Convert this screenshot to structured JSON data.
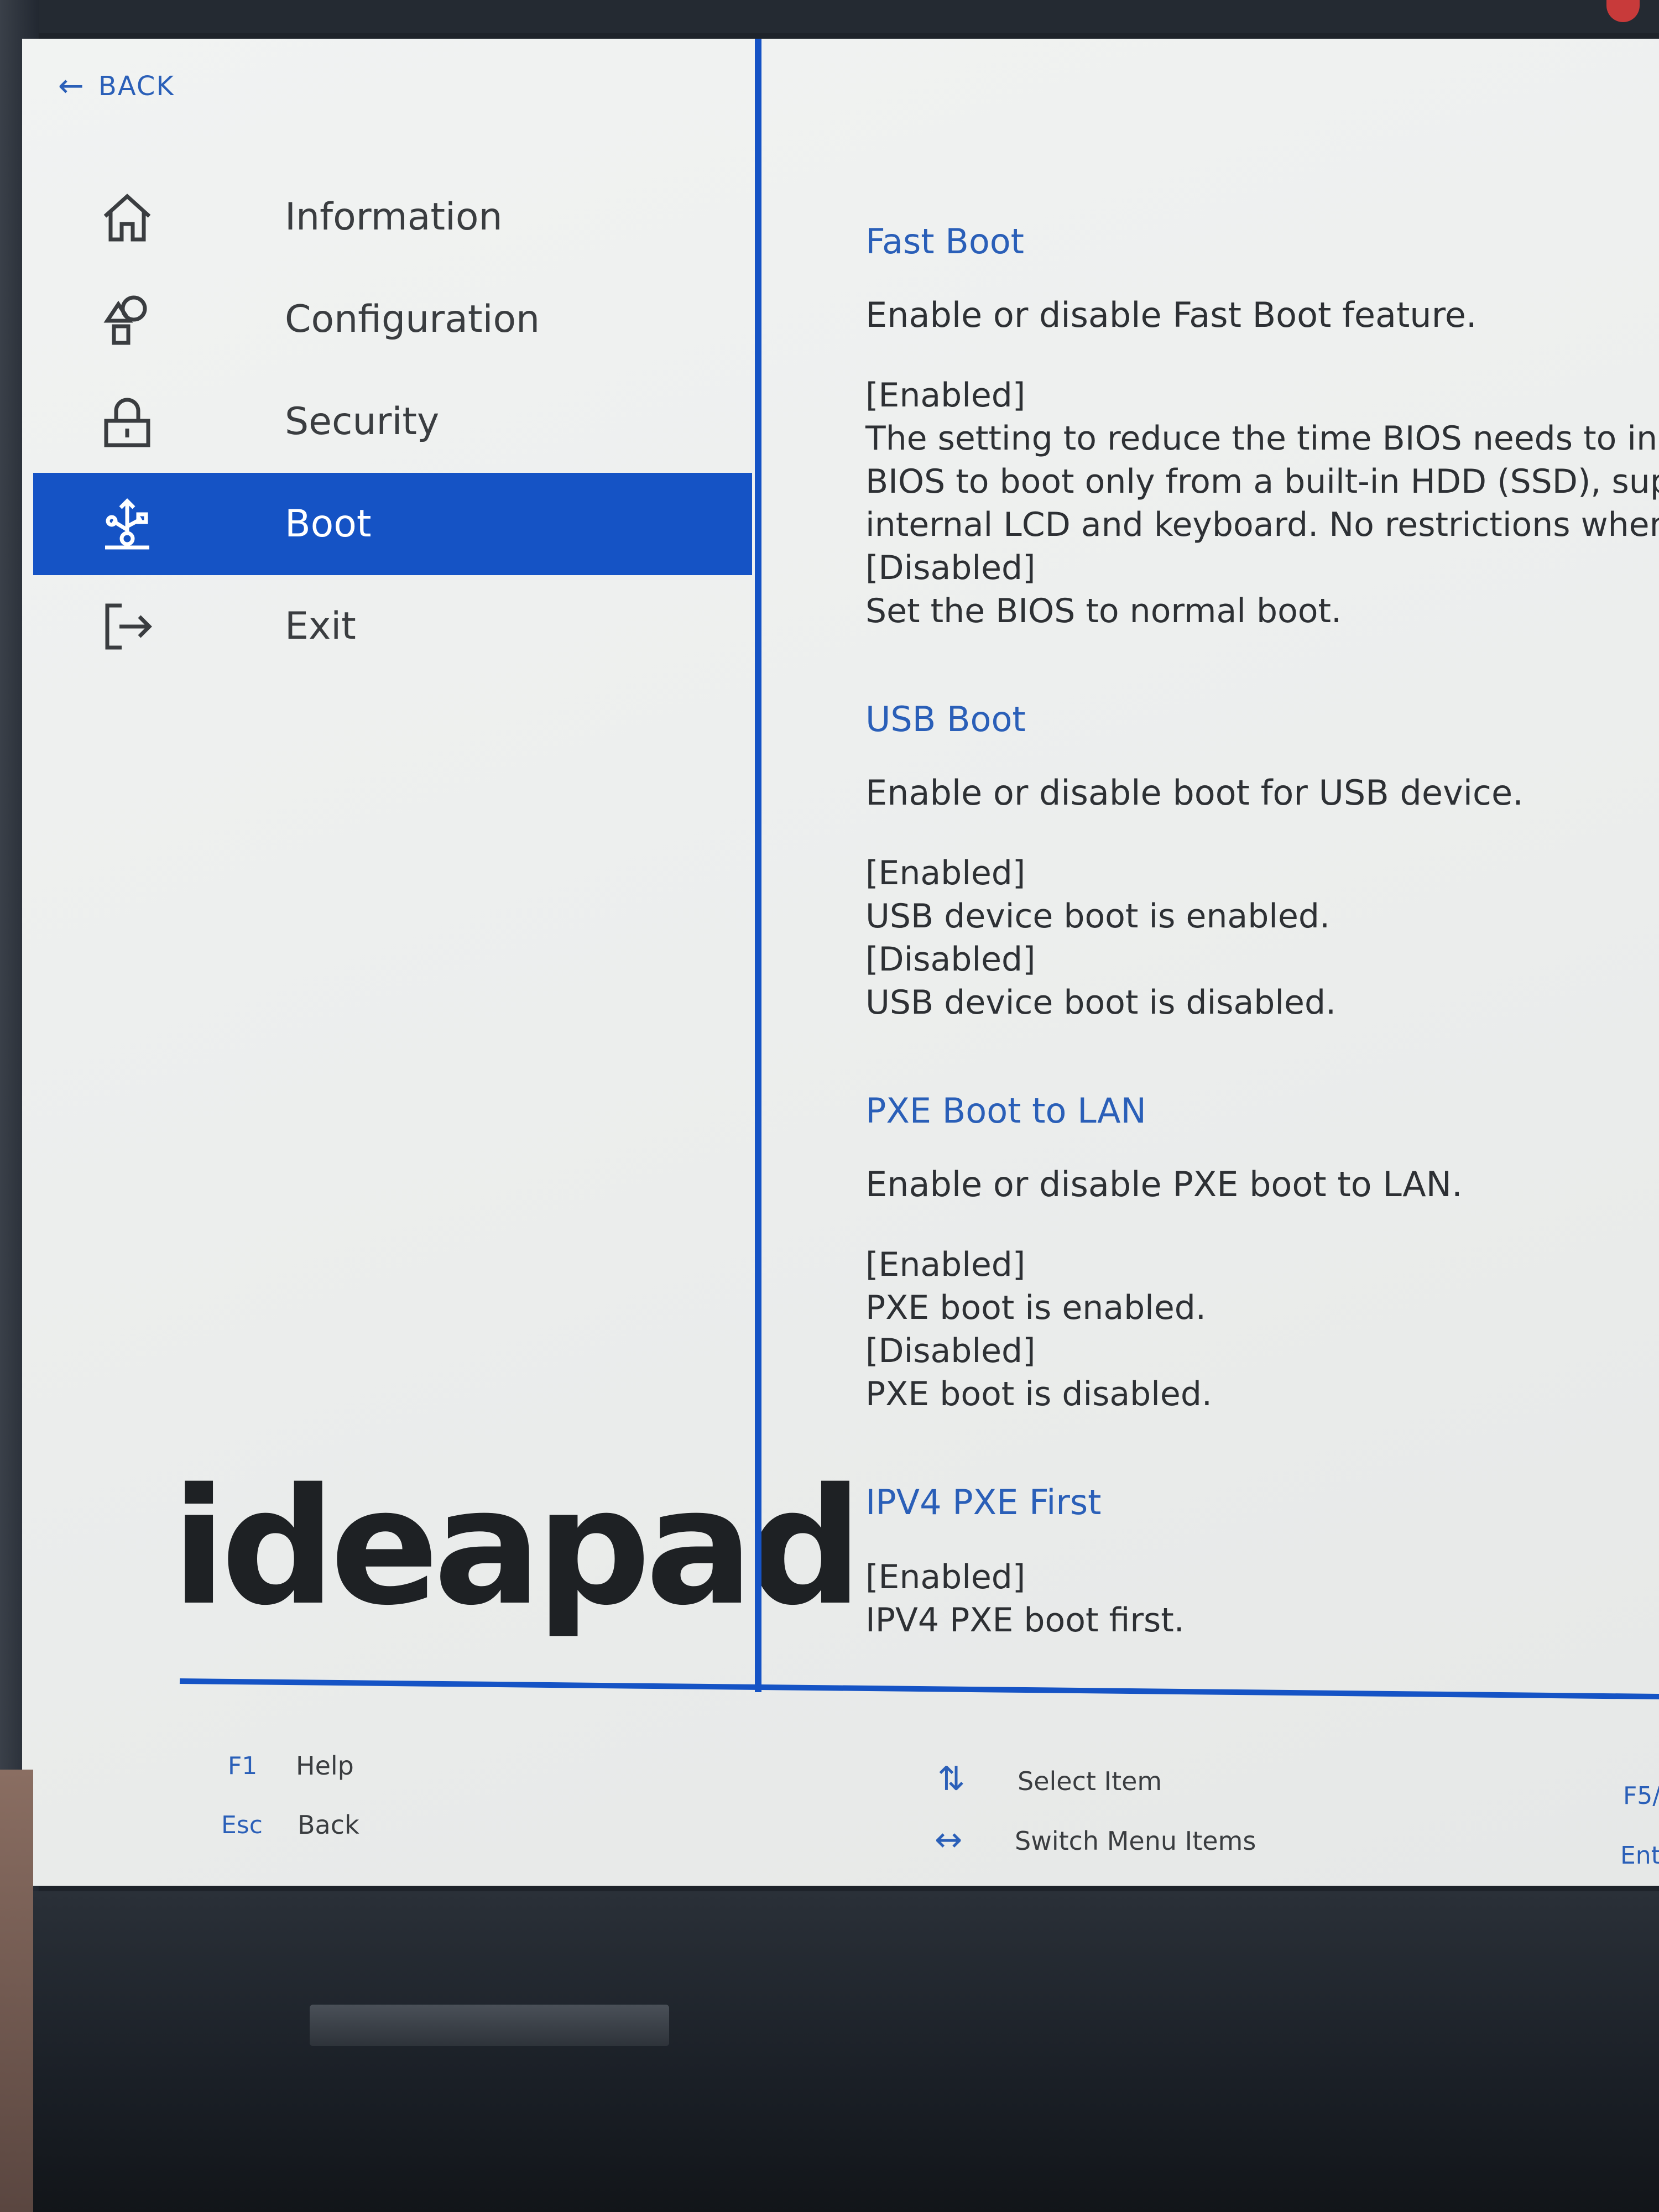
{
  "header": {
    "back_label": "BACK"
  },
  "nav": {
    "items": [
      {
        "label": "Information",
        "icon": "home-icon",
        "active": false
      },
      {
        "label": "Configuration",
        "icon": "configuration-icon",
        "active": false
      },
      {
        "label": "Security",
        "icon": "lock-icon",
        "active": false
      },
      {
        "label": "Boot",
        "icon": "usb-boot-icon",
        "active": true
      },
      {
        "label": "Exit",
        "icon": "exit-icon",
        "active": false
      }
    ]
  },
  "brand": {
    "logo_text": "ideapad"
  },
  "help": {
    "sections": [
      {
        "title": "Fast Boot",
        "description": "Enable or disable Fast Boot feature.",
        "lines": [
          "[Enabled]",
          "The setting to reduce the time BIOS needs to initial",
          "BIOS to boot only from a built-in HDD (SSD), suppor",
          "internal LCD and keyboard. No restrictions when us",
          "[Disabled]",
          "Set the BIOS to normal boot."
        ]
      },
      {
        "title": "USB Boot",
        "description": "Enable or disable boot for USB device.",
        "lines": [
          "[Enabled]",
          "USB device boot is enabled.",
          "[Disabled]",
          "USB device boot is disabled."
        ]
      },
      {
        "title": "PXE Boot to LAN",
        "description": "Enable or disable PXE boot to LAN.",
        "lines": [
          "[Enabled]",
          "PXE boot is enabled.",
          "[Disabled]",
          "PXE boot is disabled."
        ]
      },
      {
        "title": "IPV4 PXE First",
        "description": "",
        "lines": [
          "[Enabled]",
          "IPV4 PXE boot first."
        ]
      }
    ]
  },
  "footer": {
    "help_key": "F1",
    "help_label": "Help",
    "back_key": "Esc",
    "back_label": "Back",
    "select_icon": "up-down-arrows-icon",
    "select_label": "Select Item",
    "switch_icon": "left-right-arrows-icon",
    "switch_label": "Switch Menu Items",
    "right_key_1": "F5/",
    "right_key_2": "Ent"
  },
  "colors": {
    "accent": "#1553c5",
    "link": "#2a5fb8",
    "text": "#2d3034"
  }
}
